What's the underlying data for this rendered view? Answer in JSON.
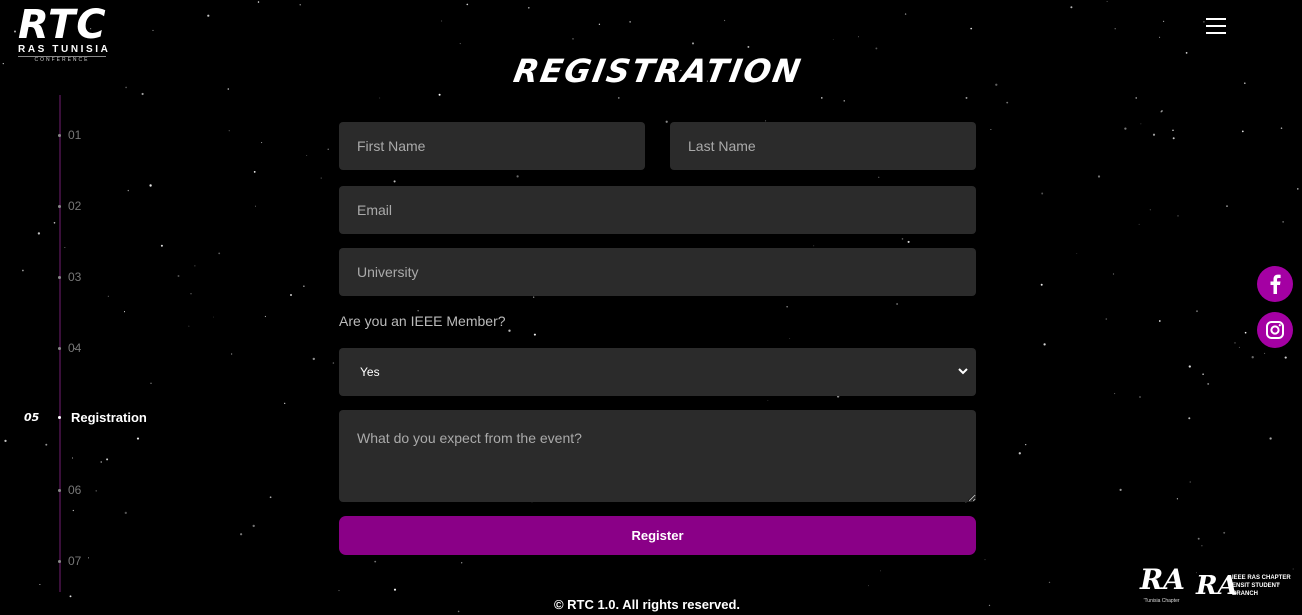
{
  "logo": {
    "title": "RTC",
    "subtitle": "RAS TUNISIA",
    "tagline": "CONFERENCE"
  },
  "nav": {
    "steps": [
      "01",
      "02",
      "03",
      "04",
      "06",
      "07"
    ],
    "active": {
      "number": "05",
      "label": "Registration"
    }
  },
  "page": {
    "title": "REGISTRATION"
  },
  "form": {
    "first_name_placeholder": "First Name",
    "last_name_placeholder": "Last Name",
    "email_placeholder": "Email",
    "university_placeholder": "University",
    "member_question": "Are you an IEEE Member?",
    "member_selected": "Yes",
    "expectation_placeholder": "What do you expect from the event?",
    "submit_label": "Register"
  },
  "social": [
    "facebook-icon",
    "instagram-icon"
  ],
  "footer": {
    "copyright": "© RTC 1.0. All rights reserved."
  },
  "partners": {
    "left": {
      "mark": "RA",
      "caption": "Tunisia Chapter"
    },
    "right": {
      "mark": "RA",
      "line1": "IEEE RAS CHAPTER",
      "line2": "ENSIT STUDENT BRANCH"
    }
  },
  "colors": {
    "accent": "#8a0087",
    "social": "#a400a3",
    "field": "#2b2b2b",
    "background": "#000000"
  }
}
